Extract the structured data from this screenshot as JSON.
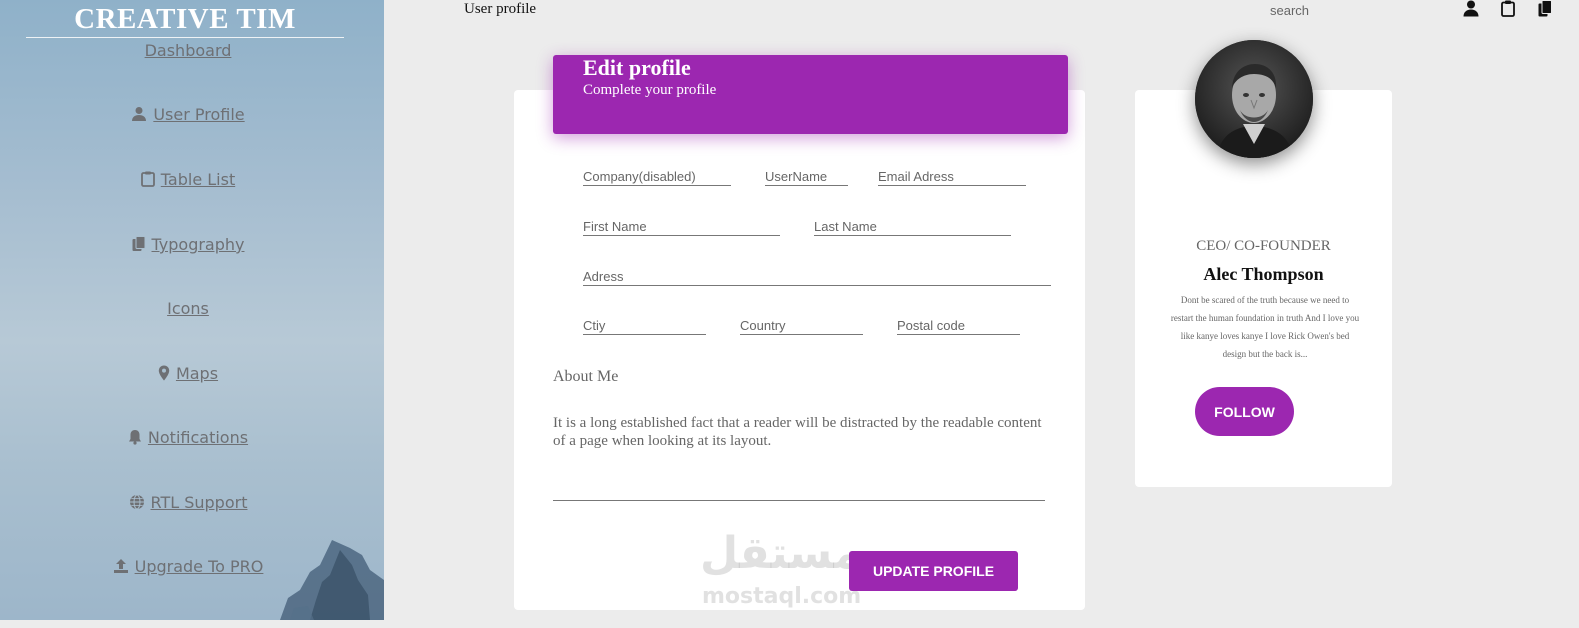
{
  "sidebar": {
    "brand": "CREATIVE TIM",
    "items": [
      {
        "label": "Dashboard",
        "icon": ""
      },
      {
        "label": "User Profile",
        "icon": "user-icon"
      },
      {
        "label": "Table List",
        "icon": "clipboard-icon"
      },
      {
        "label": "Typography",
        "icon": "copy-icon"
      },
      {
        "label": "Icons",
        "icon": ""
      },
      {
        "label": "Maps",
        "icon": "map-pin-icon"
      },
      {
        "label": "Notifications",
        "icon": "bell-icon"
      },
      {
        "label": "RTL Support",
        "icon": "globe-icon"
      },
      {
        "label": "Upgrade To PRO",
        "icon": "upload-icon"
      }
    ]
  },
  "topbar": {
    "title": "User profile",
    "search_placeholder": "search",
    "icons": [
      "user-icon",
      "clipboard-icon",
      "copy-icon"
    ]
  },
  "edit_profile": {
    "title": "Edit profile",
    "subtitle": "Complete your profile",
    "fields": {
      "company": "Company(disabled)",
      "username": "UserName",
      "email": "Email Adress",
      "first_name": "First Name",
      "last_name": "Last Name",
      "address": "Adress",
      "city": "Ctiy",
      "country": "Country",
      "postal": "Postal code"
    },
    "about_label": "About Me",
    "about_text": "It is a long established fact that a reader will be distracted by the readable content of a page when looking at its layout.",
    "update_button": "UPDATE PROFILE"
  },
  "profile_card": {
    "role": "CEO/ CO-FOUNDER",
    "name": "Alec Thompson",
    "bio": "Dont be scared of the truth because we need to restart the human foundation in truth And I love you like kanye loves kanye I love Rick Owen's bed design but the back is...",
    "follow_button": "FOLLOW"
  },
  "watermark": {
    "arabic": "مستقل",
    "latin": "mostaql.com"
  },
  "colors": {
    "accent": "#9c27b0",
    "page_bg": "#ececec",
    "card_bg": "#ffffff",
    "sidebar_text": "#6e7074"
  }
}
